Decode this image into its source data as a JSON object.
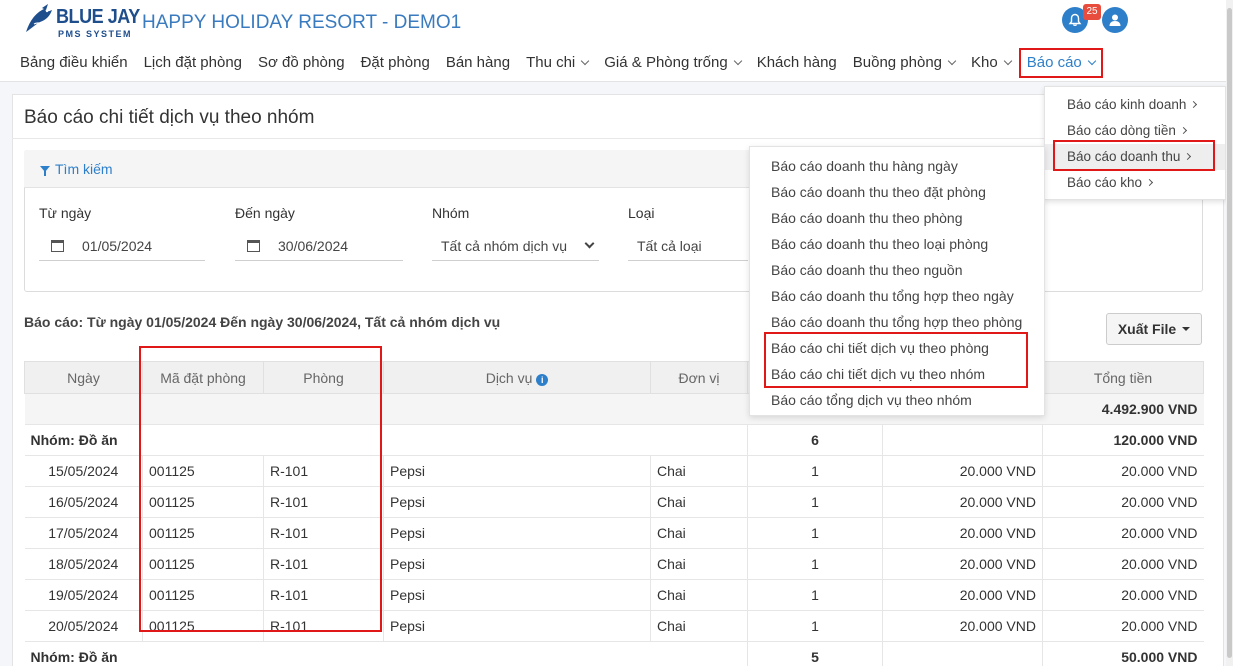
{
  "app": {
    "logo_text": "BLUE JAY",
    "logo_sub": "PMS SYSTEM",
    "resort_title": "HAPPY HOLIDAY RESORT - DEMO1",
    "notification_count": "25"
  },
  "nav": [
    {
      "label": "Bảng điều khiển",
      "has_menu": false
    },
    {
      "label": "Lịch đặt phòng",
      "has_menu": false
    },
    {
      "label": "Sơ đồ phòng",
      "has_menu": false
    },
    {
      "label": "Đặt phòng",
      "has_menu": false
    },
    {
      "label": "Bán hàng",
      "has_menu": false
    },
    {
      "label": "Thu chi",
      "has_menu": true
    },
    {
      "label": "Giá & Phòng trống",
      "has_menu": true
    },
    {
      "label": "Khách hàng",
      "has_menu": false
    },
    {
      "label": "Buồng phòng",
      "has_menu": true
    },
    {
      "label": "Kho",
      "has_menu": true
    },
    {
      "label": "Báo cáo",
      "has_menu": true,
      "active": true
    }
  ],
  "page": {
    "title": "Báo cáo chi tiết dịch vụ theo nhóm"
  },
  "search": {
    "title": "Tìm kiếm",
    "from_label": "Từ ngày",
    "from_value": "01/05/2024",
    "to_label": "Đến ngày",
    "to_value": "30/06/2024",
    "group_label": "Nhóm",
    "group_value": "Tất cả nhóm dịch vụ",
    "type_label": "Loại",
    "type_value": "Tất cả loại"
  },
  "report": {
    "summary": "Báo cáo: Từ ngày 01/05/2024 Đến ngày 30/06/2024, Tất cả nhóm dịch vụ",
    "export_label": "Xuất File"
  },
  "table": {
    "headers": [
      "Ngày",
      "Mã đặt phòng",
      "Phòng",
      "Dịch vụ",
      "Đơn vị",
      "",
      "",
      "Tổng tiền"
    ],
    "grand_total": "4.492.900 VND",
    "groups": [
      {
        "label": "Nhóm: Đồ ăn",
        "qty": "6",
        "total": "120.000 VND",
        "rows": [
          {
            "date": "15/05/2024",
            "code": "001125",
            "room": "R-101",
            "service": "Pepsi",
            "unit": "Chai",
            "qty": "1",
            "price": "20.000 VND",
            "total": "20.000 VND"
          },
          {
            "date": "16/05/2024",
            "code": "001125",
            "room": "R-101",
            "service": "Pepsi",
            "unit": "Chai",
            "qty": "1",
            "price": "20.000 VND",
            "total": "20.000 VND"
          },
          {
            "date": "17/05/2024",
            "code": "001125",
            "room": "R-101",
            "service": "Pepsi",
            "unit": "Chai",
            "qty": "1",
            "price": "20.000 VND",
            "total": "20.000 VND"
          },
          {
            "date": "18/05/2024",
            "code": "001125",
            "room": "R-101",
            "service": "Pepsi",
            "unit": "Chai",
            "qty": "1",
            "price": "20.000 VND",
            "total": "20.000 VND"
          },
          {
            "date": "19/05/2024",
            "code": "001125",
            "room": "R-101",
            "service": "Pepsi",
            "unit": "Chai",
            "qty": "1",
            "price": "20.000 VND",
            "total": "20.000 VND"
          },
          {
            "date": "20/05/2024",
            "code": "001125",
            "room": "R-101",
            "service": "Pepsi",
            "unit": "Chai",
            "qty": "1",
            "price": "20.000 VND",
            "total": "20.000 VND"
          }
        ]
      },
      {
        "label": "Nhóm: Đồ ăn",
        "qty": "5",
        "total": "50.000 VND",
        "rows": []
      }
    ]
  },
  "report_menu": {
    "items": [
      {
        "label": "Báo cáo kinh doanh"
      },
      {
        "label": "Báo cáo dòng tiền"
      },
      {
        "label": "Báo cáo doanh thu",
        "hover": true
      },
      {
        "label": "Báo cáo kho"
      }
    ]
  },
  "revenue_menu": {
    "items": [
      "Báo cáo doanh thu hàng ngày",
      "Báo cáo doanh thu theo đặt phòng",
      "Báo cáo doanh thu theo phòng",
      "Báo cáo doanh thu theo loại phòng",
      "Báo cáo doanh thu theo nguồn",
      "Báo cáo doanh thu tổng hợp theo ngày",
      "Báo cáo doanh thu tổng hợp theo phòng",
      "Báo cáo chi tiết dịch vụ theo phòng",
      "Báo cáo chi tiết dịch vụ theo nhóm",
      "Báo cáo tổng dịch vụ theo nhóm"
    ]
  },
  "colors": {
    "accent": "#2e7fc9",
    "highlight": "#e01818",
    "badge": "#e74c3c"
  }
}
